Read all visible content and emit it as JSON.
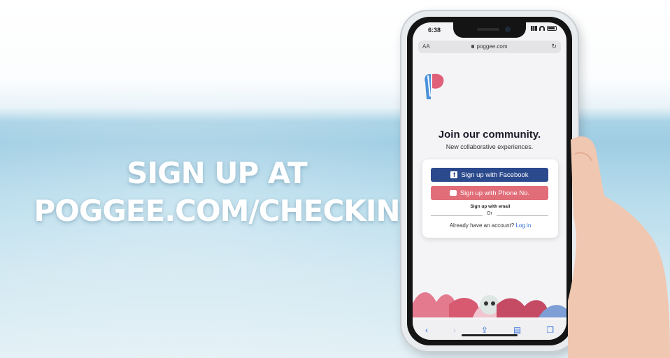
{
  "headline": {
    "line1": "SIGN UP AT",
    "line2": "POGGEE.COM/CHECKIN"
  },
  "phone": {
    "status_time": "6:38",
    "browser": {
      "text_size": "AA",
      "url": "poggee.com"
    },
    "logo_text": "Poggee",
    "title": "Join our community.",
    "subtitle": "New collaborative experiences.",
    "facebook_button": "Sign up with Facebook",
    "phone_button": "Sign up with Phone No.",
    "email_link": "Sign up with email",
    "or_label": "Or",
    "account_prompt": "Already have an account?",
    "login_link": "Log in",
    "toolbar_icons": [
      "back-icon",
      "forward-icon",
      "share-icon",
      "bookmarks-icon",
      "tabs-icon"
    ]
  },
  "colors": {
    "brand_pink": "#e0607a",
    "brand_blue": "#4a90d9",
    "facebook_blue": "#2b4a8d",
    "phone_red": "#e06d78",
    "link_blue": "#2d6fd6"
  }
}
